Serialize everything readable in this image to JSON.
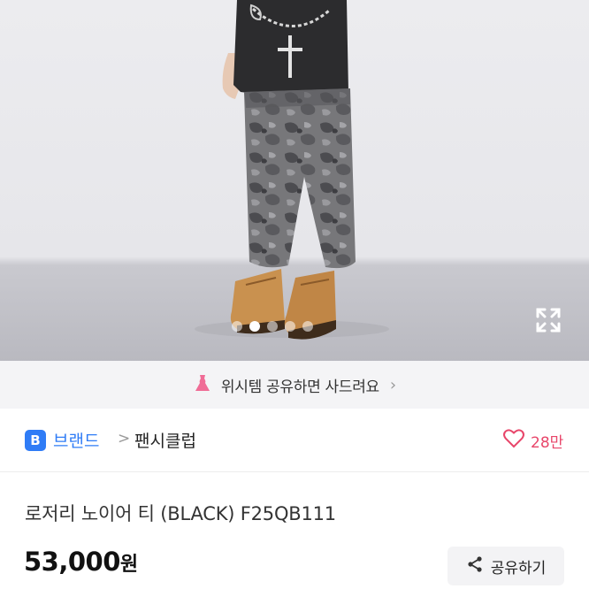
{
  "gallery": {
    "image_alt": "product photo",
    "total_images": 5,
    "active_index": 1
  },
  "wish_banner": {
    "text": "위시템 공유하면 사드려요",
    "icon": "dress-icon",
    "chevron": "›"
  },
  "brand": {
    "badge": "B",
    "link_label": "브랜드",
    "separator": ">",
    "name": "팬시클럽",
    "like_count": "28만"
  },
  "product": {
    "title": "로저리 노이어 티 (BLACK) F25QB111",
    "price": "53,000",
    "price_unit": "원"
  },
  "actions": {
    "share_label": "공유하기"
  },
  "colors": {
    "accent_blue": "#2f7cf6",
    "like_pink": "#e8466a",
    "banner_pink": "#f06c96"
  }
}
